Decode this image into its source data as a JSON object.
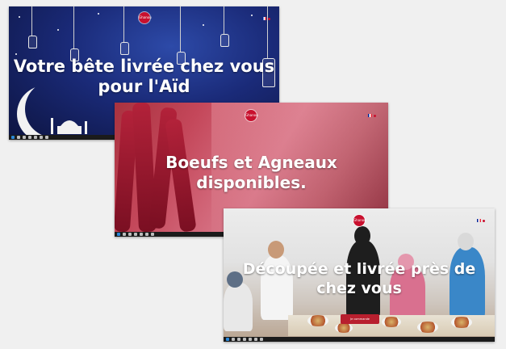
{
  "screens": [
    {
      "headline_line1": "Votre bête livrée chez vous",
      "headline_line2": "pour l'Aïd"
    },
    {
      "headline_line1": "Boeufs et Agneaux",
      "headline_line2": "disponibles."
    },
    {
      "headline_line1": "Découpée et livrée près de",
      "headline_line2": "chez vous",
      "cta_label": "Je commande"
    }
  ],
  "logo_text": "Ghanou",
  "colors": {
    "brand_red": "#c8102e",
    "page_bg": "#f0f0f0"
  },
  "icons": [
    "windows-start-icon",
    "search-icon",
    "task-view-icon",
    "browser-icon",
    "folder-icon",
    "store-icon",
    "mail-icon"
  ]
}
